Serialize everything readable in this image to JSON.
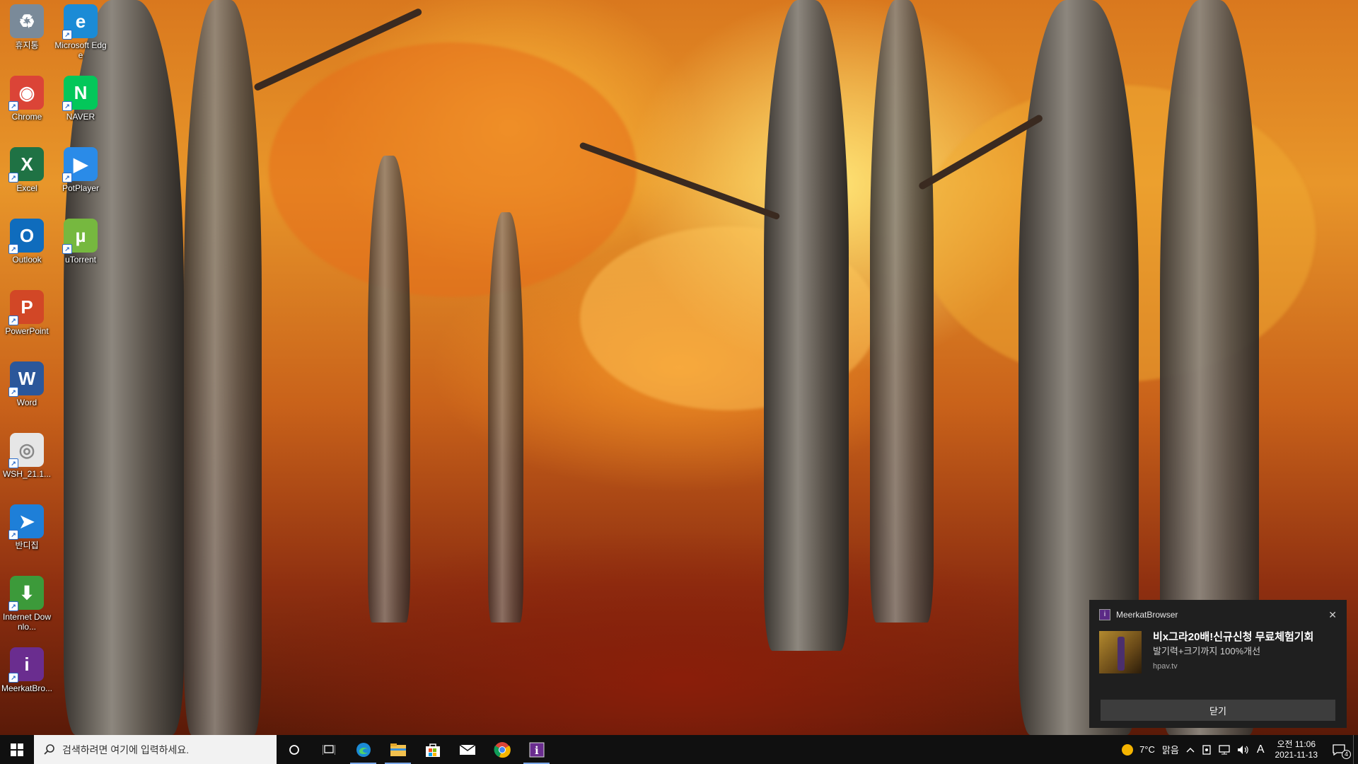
{
  "desktop": {
    "icons": [
      {
        "label": "휴지통",
        "icon": "recycle-bin-icon",
        "color": "#7a8a99"
      },
      {
        "label": "Microsoft Edge",
        "icon": "edge-icon",
        "color": "#1b8bd6"
      },
      {
        "label": "Chrome",
        "icon": "chrome-icon",
        "color": "#db4437"
      },
      {
        "label": "NAVER",
        "icon": "naver-icon",
        "color": "#03c75a"
      },
      {
        "label": "Excel",
        "icon": "excel-icon",
        "color": "#1f7244"
      },
      {
        "label": "PotPlayer",
        "icon": "potplayer-icon",
        "color": "#2a8be8"
      },
      {
        "label": "Outlook",
        "icon": "outlook-icon",
        "color": "#0f6cbd"
      },
      {
        "label": "uTorrent",
        "icon": "utorrent-icon",
        "color": "#76b83f"
      },
      {
        "label": "PowerPoint",
        "icon": "powerpoint-icon",
        "color": "#d24726"
      },
      {
        "label": "Word",
        "icon": "word-icon",
        "color": "#2b579a"
      },
      {
        "label": "WSH_21.1...",
        "icon": "document-icon",
        "color": "#e6e6e6"
      },
      {
        "label": "반디집",
        "icon": "bandizip-icon",
        "color": "#1e7fd8"
      },
      {
        "label": "Internet Downlo...",
        "icon": "internet-download-manager-icon",
        "color": "#3c9a3a"
      },
      {
        "label": "MeerkatBro...",
        "icon": "meerkat-browser-icon",
        "color": "#6a2d8f"
      }
    ]
  },
  "taskbar": {
    "search_placeholder": "검색하려면 여기에 입력하세요.",
    "pinned": [
      "edge-icon",
      "file-explorer-icon",
      "store-icon",
      "mail-icon",
      "chrome-icon",
      "meerkat-browser-icon"
    ],
    "weather_temp": "7°C",
    "weather_desc": "맑음",
    "ime": "A",
    "time": "오전 11:06",
    "date": "2021-11-13",
    "notification_count": "4"
  },
  "toast": {
    "app_name": "MeerkatBrowser",
    "title": "비x그라20배!신규신청 무료체험기회",
    "subtitle": "발기력+크기까지 100%개선",
    "source": "hpav.tv",
    "button_label": "닫기"
  }
}
